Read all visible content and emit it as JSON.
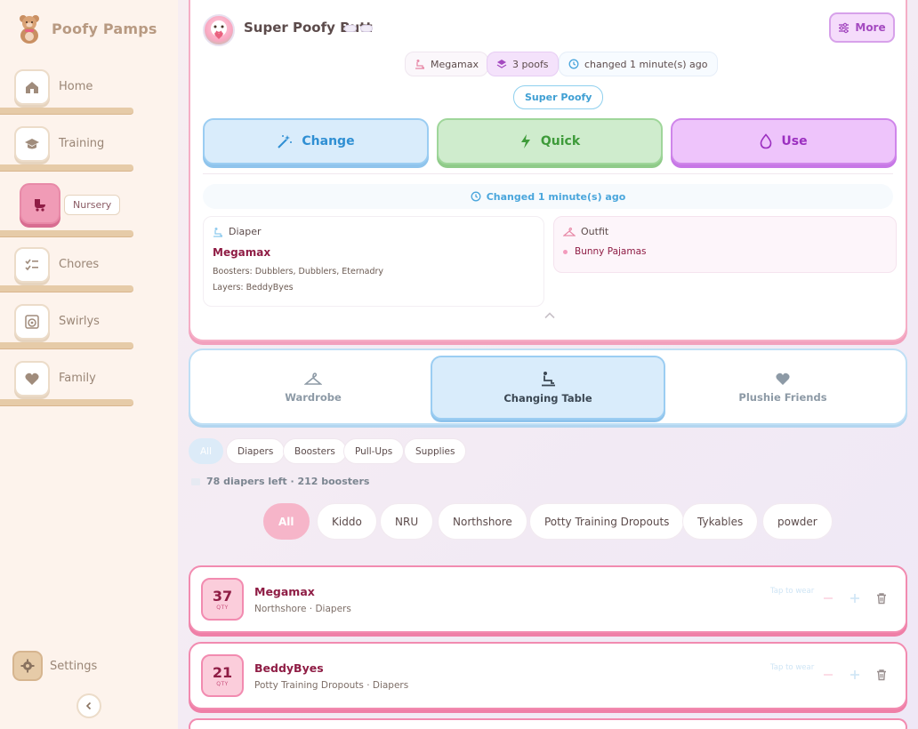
{
  "app": {
    "name": "Poofy Pamps"
  },
  "sidebar": {
    "items": [
      {
        "label": "Home",
        "icon": "home-icon"
      },
      {
        "label": "Training",
        "icon": "graduation-cap-icon"
      },
      {
        "label": "Nursery",
        "icon": "stroller-icon",
        "active": true
      },
      {
        "label": "Chores",
        "icon": "checklist-icon"
      },
      {
        "label": "Swirlys",
        "icon": "washing-machine-icon"
      },
      {
        "label": "Family",
        "icon": "heart-icon"
      }
    ],
    "settings_label": "Settings"
  },
  "profile": {
    "name": "Super Poofy Butt",
    "more_label": "More",
    "chips": {
      "brand": "Megamax",
      "poofs": "3 poofs",
      "changed": "changed 1 minute(s) ago"
    },
    "level_badge": "Super Poofy",
    "actions": {
      "change": "Change",
      "quick": "Quick",
      "use": "Use"
    },
    "changed_banner": "Changed 1 minute(s) ago",
    "diaper": {
      "header": "Diaper",
      "name": "Megamax",
      "boosters": "Boosters: Dubblers, Dubblers, Eternadry",
      "layers": "Layers: BeddyByes"
    },
    "outfit": {
      "header": "Outfit",
      "item": "Bunny Pajamas"
    }
  },
  "tabs": [
    {
      "label": "Wardrobe",
      "icon": "hanger-icon"
    },
    {
      "label": "Changing Table",
      "icon": "changing-table-icon",
      "active": true
    },
    {
      "label": "Plushie Friends",
      "icon": "heart-icon"
    }
  ],
  "filters": {
    "categories": [
      "All",
      "Diapers",
      "Boosters",
      "Pull-Ups",
      "Supplies"
    ],
    "active_category": "All",
    "counts": "78 diapers left · 212 boosters",
    "brands": [
      "All",
      "Kiddo",
      "NRU",
      "Northshore",
      "Potty Training Dropouts",
      "Tykables",
      "powder"
    ],
    "active_brand": "All"
  },
  "inventory": [
    {
      "qty": "37",
      "qty_label": "QTY",
      "name": "Megamax",
      "meta": "Northshore · Diapers",
      "tap_hint": "Tap to wear"
    },
    {
      "qty": "21",
      "qty_label": "QTY",
      "name": "BeddyByes",
      "meta": "Potty Training Dropouts · Diapers",
      "tap_hint": "Tap to wear"
    }
  ],
  "colors": {
    "pink_accent": "#f28bb0",
    "blue_accent": "#9bcdf2",
    "green_accent": "#9fd69a",
    "purple_accent": "#cf86ea",
    "maroon_text": "#8f1d45"
  }
}
